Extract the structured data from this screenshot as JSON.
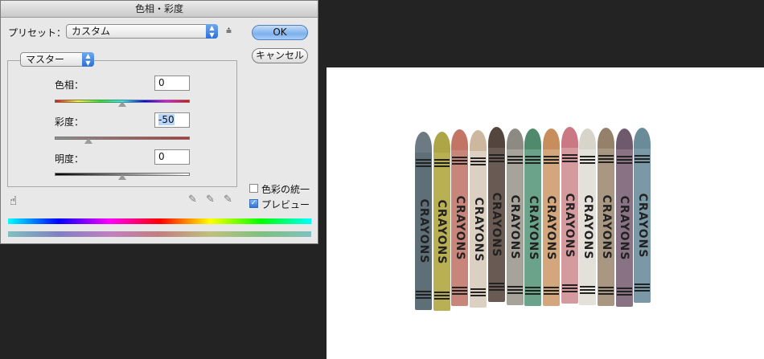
{
  "dialog": {
    "title": "色相・彩度",
    "preset_label": "プリセット：",
    "preset_value": "カスタム",
    "ok": "OK",
    "cancel": "キャンセル",
    "channel_value": "マスター",
    "hue_label": "色相：",
    "hue_value": "0",
    "hue_level": 0.5,
    "saturation_label": "彩度：",
    "saturation_value": "-50",
    "saturation_level": 0.25,
    "lightness_label": "明度：",
    "lightness_value": "0",
    "lightness_level": 0.5,
    "colorize_label": "色彩の統一",
    "colorize_checked": false,
    "preview_label": "プレビュー",
    "preview_checked": true
  },
  "canvas": {
    "crayon_label": "CRAYONS",
    "crayons": [
      {
        "color": "#5f6f78",
        "tip": "#6b7a83"
      },
      {
        "color": "#b9b053",
        "tip": "#aea646"
      },
      {
        "color": "#c8857a",
        "tip": "#c27565"
      },
      {
        "color": "#dcd0c2",
        "tip": "#cdb89f"
      },
      {
        "color": "#6a5a54",
        "tip": "#54463f"
      },
      {
        "color": "#a7a39a",
        "tip": "#8c8a82"
      },
      {
        "color": "#6aa389",
        "tip": "#4f8a6c"
      },
      {
        "color": "#d3a67c",
        "tip": "#c88d5c"
      },
      {
        "color": "#d59a9e",
        "tip": "#c97884"
      },
      {
        "color": "#e3e1d9",
        "tip": "#d7d4c9"
      },
      {
        "color": "#a99782",
        "tip": "#95806a"
      },
      {
        "color": "#8a7285",
        "tip": "#6f5a6d"
      },
      {
        "color": "#7a98a6",
        "tip": "#6a8c99"
      }
    ]
  }
}
